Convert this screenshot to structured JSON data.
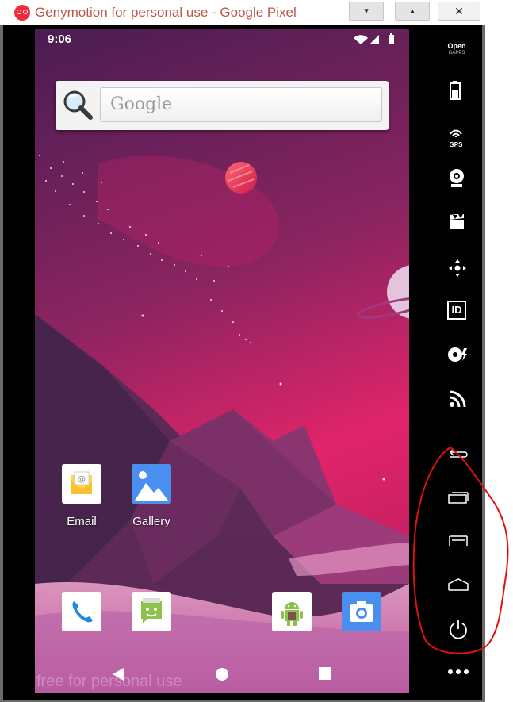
{
  "window": {
    "title": "Genymotion for personal use - Google Pixel",
    "minimize_label": "▾",
    "maximize_label": "▴",
    "close_label": "✕"
  },
  "statusbar": {
    "time": "9:06",
    "icons": [
      "wifi-icon",
      "signal-icon",
      "battery-icon"
    ]
  },
  "search": {
    "placeholder": "Google"
  },
  "apps": [
    {
      "label": "Email",
      "icon": "email-icon"
    },
    {
      "label": "Gallery",
      "icon": "gallery-icon"
    }
  ],
  "dock": [
    "phone-icon",
    "messaging-icon",
    "android-app-icon",
    "camera-icon"
  ],
  "navbar": [
    "back-icon",
    "home-icon",
    "recents-icon"
  ],
  "watermark": "free for personal use",
  "toolbar": {
    "opengapps_label": "Open",
    "opengapps_sub": "GAPPS",
    "gps_label": "GPS",
    "id_label": "ID",
    "tools": [
      "battery-icon",
      "gps-icon",
      "webcam-icon",
      "screencast-icon",
      "remote-control-icon",
      "identifiers-icon",
      "disk-io-icon",
      "network-icon",
      "back-icon",
      "recent-apps-icon",
      "menu-icon",
      "home-icon",
      "power-icon",
      "more-icon"
    ]
  },
  "colors": {
    "sky_top": "#4a1d52",
    "sky_bottom": "#e0246a",
    "annotation": "#e01010"
  }
}
